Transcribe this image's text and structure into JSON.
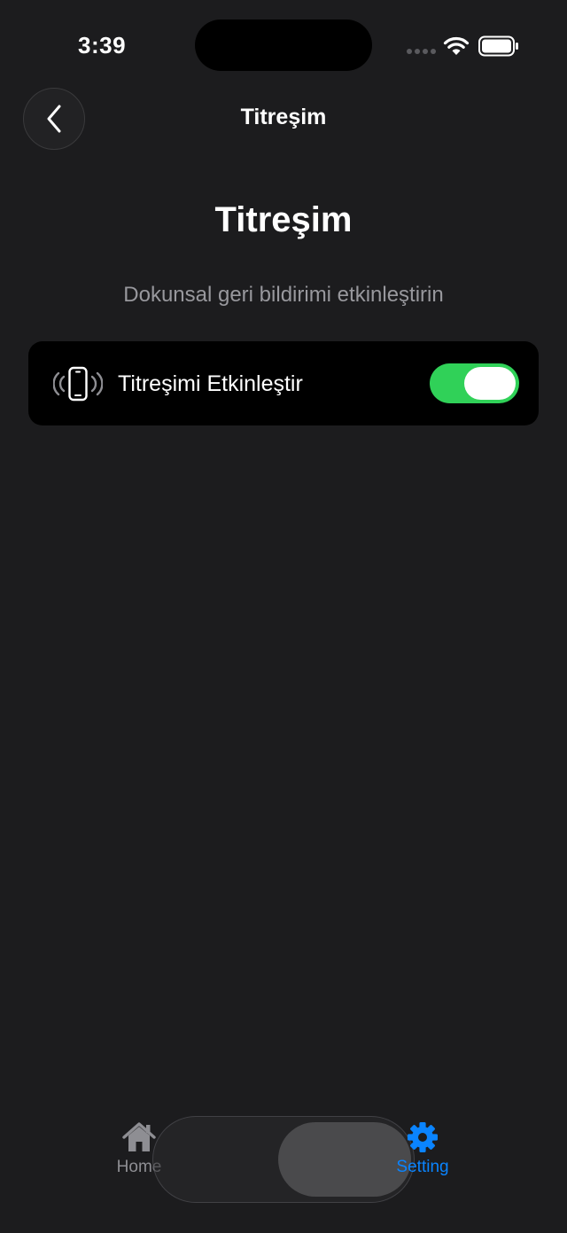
{
  "status_bar": {
    "time": "3:39",
    "icons": [
      "signal-icon",
      "wifi-icon",
      "battery-icon"
    ]
  },
  "nav": {
    "back_icon": "chevron-left-icon",
    "title": "Titreşim"
  },
  "page": {
    "title": "Titreşim",
    "subtitle": "Dokunsal geri bildirimi etkinleştirin"
  },
  "settings": {
    "vibration_row": {
      "icon": "vibrate-icon",
      "label": "Titreşimi Etkinleştir",
      "enabled": true
    }
  },
  "tab_bar": {
    "items": [
      {
        "label": "Home",
        "icon": "home-icon",
        "active": false
      },
      {
        "label": "Setting",
        "icon": "gear-icon",
        "active": true
      }
    ]
  },
  "colors": {
    "background": "#1c1c1e",
    "card": "#000000",
    "toggle_on": "#30d158",
    "accent": "#0a84ff",
    "secondary_text": "#98989d"
  }
}
